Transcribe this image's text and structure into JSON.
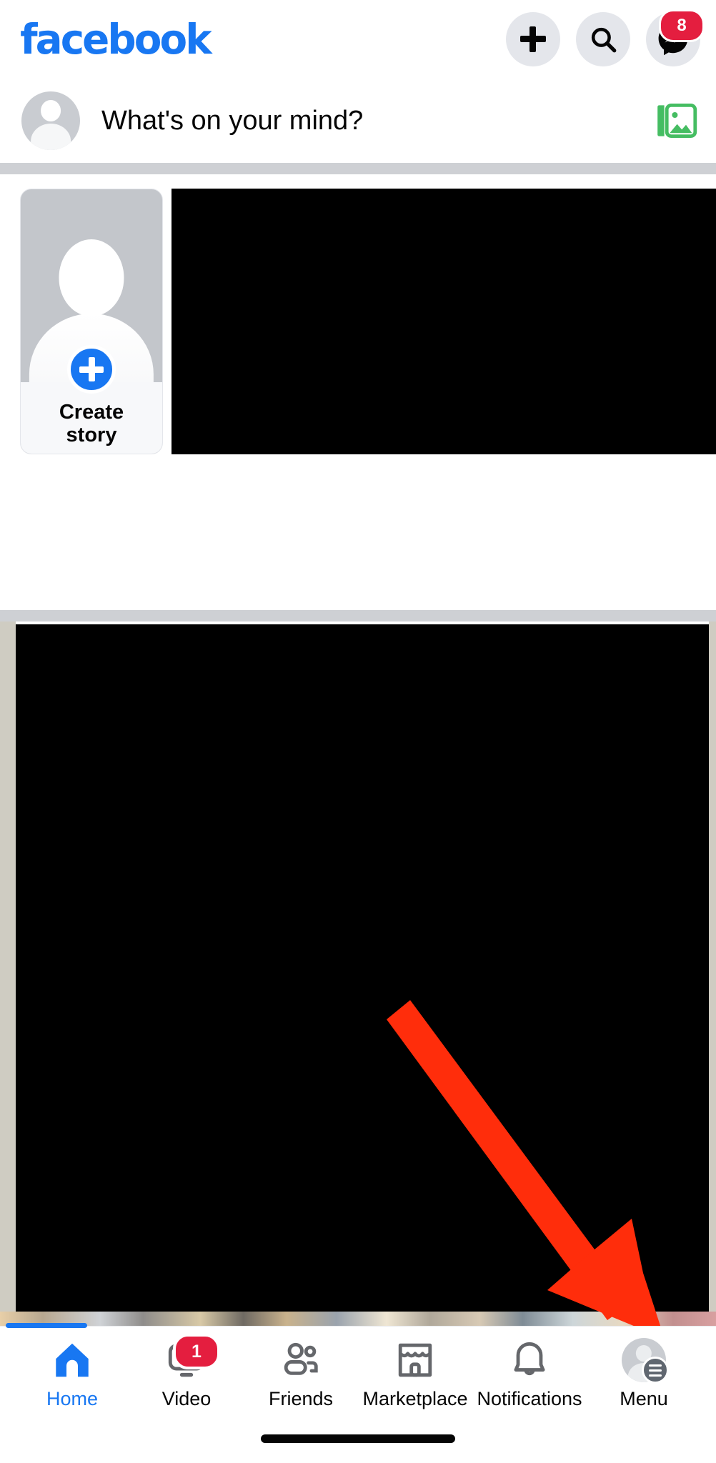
{
  "app": {
    "name": "Facebook",
    "logo_text": "facebook",
    "brand_color": "#1877F2",
    "badge_color": "#E41E3F",
    "divider_color": "#CED0D4"
  },
  "header": {
    "logo_text": "facebook",
    "actions": [
      {
        "name": "create-button",
        "icon": "plus-icon",
        "label": ""
      },
      {
        "name": "search-button",
        "icon": "search-icon",
        "label": ""
      },
      {
        "name": "messenger-button",
        "icon": "messenger-icon",
        "label": "",
        "badge": "8"
      }
    ]
  },
  "composer": {
    "placeholder": "What's on your mind?",
    "avatar_icon": "avatar-placeholder-icon",
    "photo_icon": "photo-gallery-icon",
    "photo_icon_color": "#45BD62"
  },
  "stories": {
    "create_story": {
      "line1": "Create",
      "line2": "story",
      "add_icon": "plus-circle-icon"
    },
    "next_story": {
      "name": "story-card-redacted",
      "content": ""
    }
  },
  "feed": {
    "post": {
      "name": "feed-post-redacted",
      "content": ""
    }
  },
  "annotation": {
    "type": "arrow",
    "color": "#FF2D0B",
    "points_to": "Menu",
    "label": ""
  },
  "bottom_nav": {
    "active": "Home",
    "items": [
      {
        "label": "Home",
        "icon": "home-icon",
        "active": true,
        "badge": ""
      },
      {
        "label": "Video",
        "icon": "video-icon",
        "active": false,
        "badge": "1"
      },
      {
        "label": "Friends",
        "icon": "friends-icon",
        "active": false,
        "badge": ""
      },
      {
        "label": "Marketplace",
        "icon": "marketplace-icon",
        "active": false,
        "badge": ""
      },
      {
        "label": "Notifications",
        "icon": "bell-icon",
        "active": false,
        "badge": ""
      },
      {
        "label": "Menu",
        "icon": "menu-avatar-icon",
        "active": false,
        "badge": ""
      }
    ]
  },
  "system": {
    "home_indicator": ""
  }
}
